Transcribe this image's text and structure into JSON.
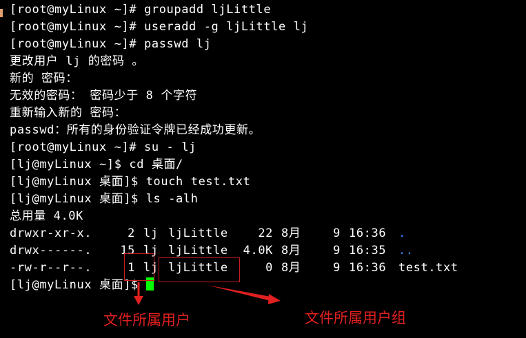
{
  "terminal": {
    "lines": [
      "[root@myLinux ~]# groupadd ljLittle",
      "[root@myLinux ~]# useradd -g ljLittle lj",
      "[root@myLinux ~]# passwd lj",
      "更改用户 lj 的密码 。",
      "新的 密码：",
      "无效的密码： 密码少于 8 个字符",
      "重新输入新的 密码：",
      "passwd：所有的身份验证令牌已经成功更新。",
      "[root@myLinux ~]# su - lj",
      "[lj@myLinux ~]$ cd 桌面/",
      "[lj@myLinux 桌面]$ touch test.txt",
      "[lj@myLinux 桌面]$ ls -alh",
      "总用量 4.0K"
    ],
    "ls_rows": [
      {
        "perms": "drwxr-xr-x.",
        "links": "2",
        "owner": "lj",
        "group": "ljLittle",
        "size": "22",
        "month": "8月",
        "day": "9",
        "time": "16:36",
        "name": "."
      },
      {
        "perms": "drwx------.",
        "links": "15",
        "owner": "lj",
        "group": "ljLittle",
        "size": "4.0K",
        "month": "8月",
        "day": "9",
        "time": "16:35",
        "name": ".."
      },
      {
        "perms": "-rw-r--r--.",
        "links": "1",
        "owner": "lj",
        "group": "ljLittle",
        "size": "0",
        "month": "8月",
        "day": "9",
        "time": "16:36",
        "name": "test.txt"
      }
    ],
    "final_prompt": "[lj@myLinux 桌面]$ ",
    "cursor_color": "#00ff00",
    "directory_color": "#3b82f6",
    "text_color": "#ffffff",
    "background_color": "#000000"
  },
  "annotations": {
    "owner_label": "文件所属用户",
    "group_label": "文件所属用户组",
    "color": "#e02020"
  }
}
